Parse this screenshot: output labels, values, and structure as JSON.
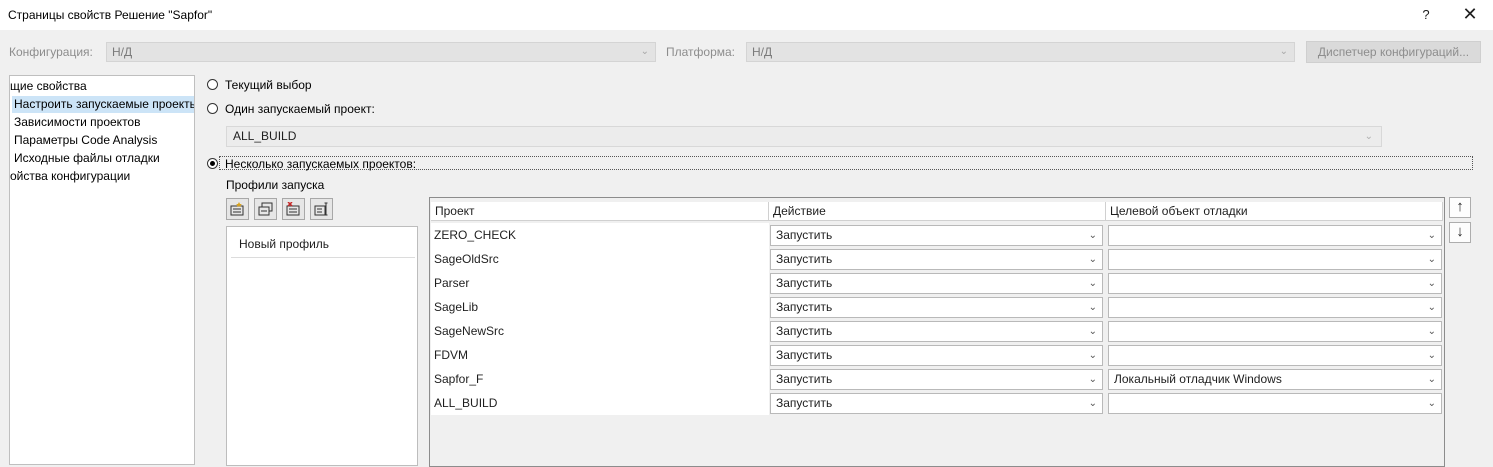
{
  "window": {
    "title": "Страницы свойств Решение \"Sapfor\"",
    "help_label": "?",
    "close_label": "✕"
  },
  "config_bar": {
    "configuration_label": "Конфигурация:",
    "configuration_value": "Н/Д",
    "platform_label": "Платформа:",
    "platform_value": "Н/Д",
    "manager_button": "Диспетчер конфигураций..."
  },
  "tree": {
    "items": [
      {
        "label": "щие свойства"
      },
      {
        "label": "Настроить запускаемые проекты"
      },
      {
        "label": "Зависимости проектов"
      },
      {
        "label": "Параметры Code Analysis"
      },
      {
        "label": "Исходные файлы отладки"
      },
      {
        "label": "ойства конфигурации"
      }
    ],
    "selected_index": 1
  },
  "startup": {
    "current_selection_label": "Текущий выбор",
    "single_project_label": "Один запускаемый проект:",
    "single_project_value": "ALL_BUILD",
    "multiple_projects_label": "Несколько запускаемых проектов:",
    "selected_option": "multiple",
    "profiles_label": "Профили запуска",
    "profiles": [
      "Новый профиль"
    ]
  },
  "grid": {
    "headers": {
      "project": "Проект",
      "action": "Действие",
      "debug_target": "Целевой объект отладки"
    },
    "rows": [
      {
        "project": "ZERO_CHECK",
        "action": "Запустить",
        "target": ""
      },
      {
        "project": "SageOldSrc",
        "action": "Запустить",
        "target": ""
      },
      {
        "project": "Parser",
        "action": "Запустить",
        "target": ""
      },
      {
        "project": "SageLib",
        "action": "Запустить",
        "target": ""
      },
      {
        "project": "SageNewSrc",
        "action": "Запустить",
        "target": ""
      },
      {
        "project": "FDVM",
        "action": "Запустить",
        "target": ""
      },
      {
        "project": "Sapfor_F",
        "action": "Запустить",
        "target": "Локальный отладчик Windows"
      },
      {
        "project": "ALL_BUILD",
        "action": "Запустить",
        "target": ""
      }
    ]
  },
  "icons": {
    "move_up": "arrow-up-icon",
    "move_down": "arrow-down-icon",
    "dropdown": "chevron-down-icon"
  }
}
